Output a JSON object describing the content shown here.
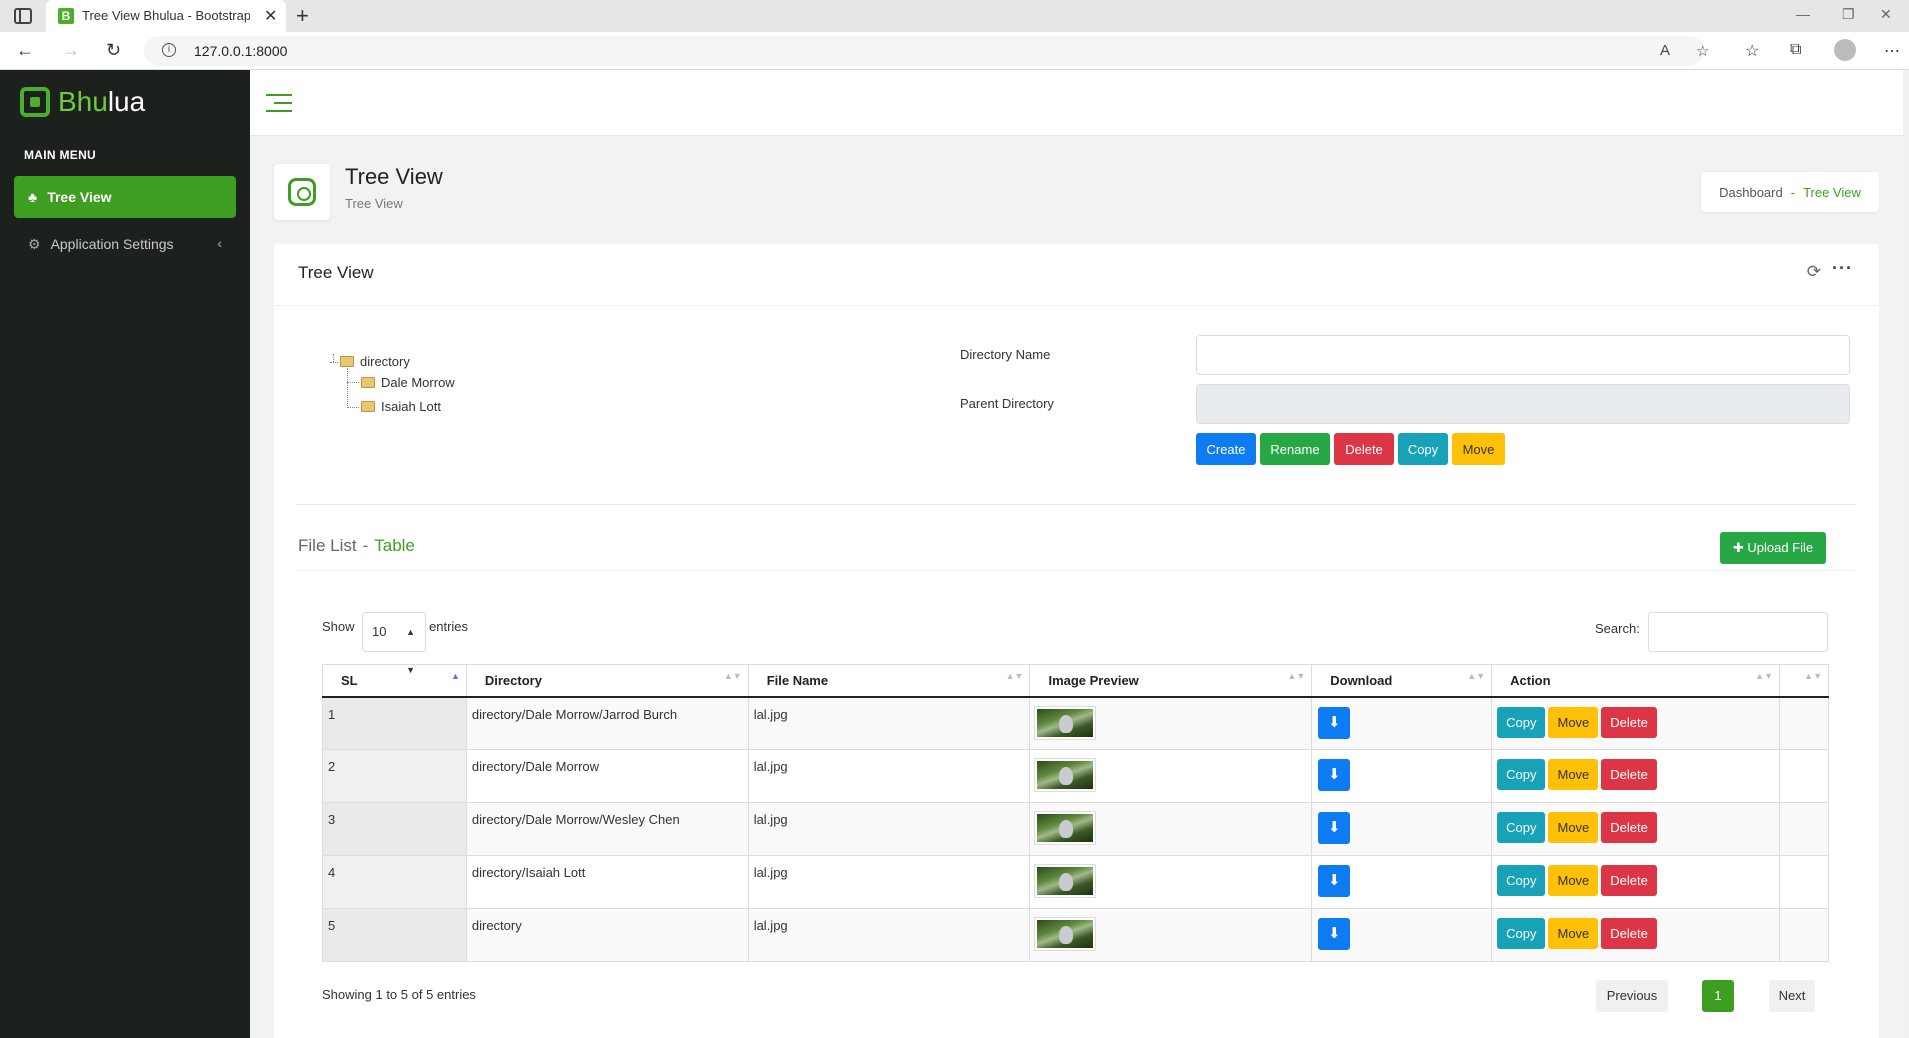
{
  "browser": {
    "tab_title": "Tree View Bhulua - Bootstrap 4 A",
    "favicon_letter": "B",
    "url": "127.0.0.1:8000"
  },
  "sidebar": {
    "brand_part1": "Bhu",
    "brand_part2": "lua",
    "menu_caption": "MAIN MENU",
    "items": [
      {
        "label": "Tree View",
        "active": true,
        "icon": "tree-icon"
      },
      {
        "label": "Application Settings",
        "active": false,
        "icon": "gear-icon"
      }
    ]
  },
  "page": {
    "title": "Tree View",
    "subtitle": "Tree View",
    "breadcrumb": [
      "Dashboard",
      "Tree View"
    ]
  },
  "card": {
    "title": "Tree View"
  },
  "tree": {
    "root": "directory",
    "children": [
      "Dale Morrow",
      "Isaiah Lott"
    ]
  },
  "form": {
    "directory_name_label": "Directory Name",
    "directory_name_value": "",
    "parent_directory_label": "Parent Directory",
    "parent_directory_value": "",
    "buttons": {
      "create": "Create",
      "rename": "Rename",
      "delete": "Delete",
      "copy": "Copy",
      "move": "Move"
    }
  },
  "file_list": {
    "title": "File List",
    "subtitle": "Table",
    "upload_label": "Upload File",
    "show_label": "Show",
    "page_size": "10",
    "entries_label": "entries",
    "search_label": "Search:",
    "columns": [
      "SL",
      "Directory",
      "File Name",
      "Image Preview",
      "Download",
      "Action"
    ],
    "rows": [
      {
        "sl": "1",
        "directory": "directory/Dale Morrow/Jarrod Burch",
        "file": "lal.jpg"
      },
      {
        "sl": "2",
        "directory": "directory/Dale Morrow",
        "file": "lal.jpg"
      },
      {
        "sl": "3",
        "directory": "directory/Dale Morrow/Wesley Chen",
        "file": "lal.jpg"
      },
      {
        "sl": "4",
        "directory": "directory/Isaiah Lott",
        "file": "lal.jpg"
      },
      {
        "sl": "5",
        "directory": "directory",
        "file": "lal.jpg"
      }
    ],
    "row_actions": {
      "copy": "Copy",
      "move": "Move",
      "delete": "Delete"
    },
    "info": "Showing 1 to 5 of 5 entries",
    "pagination": {
      "previous": "Previous",
      "current": "1",
      "next": "Next"
    }
  },
  "colors": {
    "accent": "#3e9e21",
    "sidebar_bg": "#1d211e",
    "primary": "#0d7cf2",
    "info": "#17a2b8",
    "warning": "#ffc107",
    "danger": "#dc3545",
    "success": "#28a745"
  }
}
